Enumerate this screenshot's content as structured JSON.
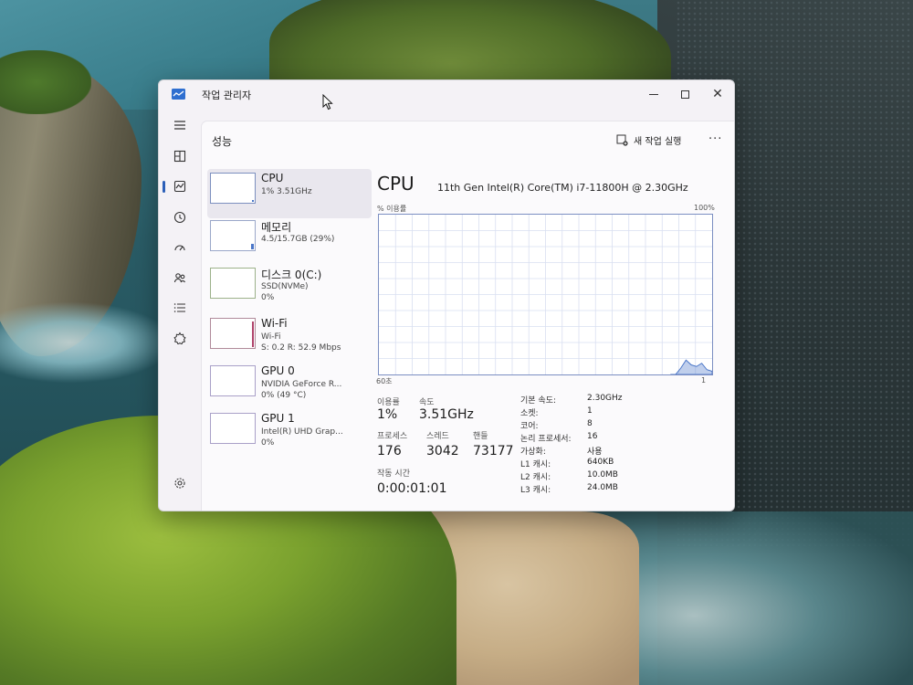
{
  "window": {
    "title": "작업 관리자",
    "page_title": "성능",
    "run_task_label": "새 작업 실행",
    "more_label": "···",
    "close_label": "✕"
  },
  "sidebar": [
    {
      "name": "hamburger-icon"
    },
    {
      "name": "processes-icon"
    },
    {
      "name": "performance-icon",
      "active": true
    },
    {
      "name": "app-history-icon"
    },
    {
      "name": "startup-apps-icon"
    },
    {
      "name": "users-icon"
    },
    {
      "name": "details-icon"
    },
    {
      "name": "services-icon"
    },
    {
      "name": "settings-icon"
    }
  ],
  "perf_items": [
    {
      "name": "CPU",
      "sub1": "1% 3.51GHz",
      "sub2": ""
    },
    {
      "name": "메모리",
      "sub1": "4.5/15.7GB (29%)",
      "sub2": ""
    },
    {
      "name": "디스크 0(C:)",
      "sub1": "SSD(NVMe)",
      "sub2": "0%"
    },
    {
      "name": "Wi-Fi",
      "sub1": "Wi-Fi",
      "sub2": "S: 0.2  R: 52.9 Mbps"
    },
    {
      "name": "GPU 0",
      "sub1": "NVIDIA GeForce R...",
      "sub2": "0% (49 °C)"
    },
    {
      "name": "GPU 1",
      "sub1": "Intel(R) UHD Grap...",
      "sub2": "0%"
    }
  ],
  "cpu": {
    "title": "CPU",
    "model": "11th Gen Intel(R) Core(TM) i7-11800H @ 2.30GHz",
    "util_label": "% 이용률",
    "util_max": "100%",
    "axis_left": "60초",
    "axis_right": "1",
    "utilization_label": "이용률",
    "utilization": "1%",
    "speed_label": "속도",
    "speed": "3.51GHz",
    "processes_label": "프로세스",
    "processes": "176",
    "threads_label": "스레드",
    "threads": "3042",
    "handles_label": "핸들",
    "handles": "73177",
    "uptime_label": "작동 시간",
    "uptime": "0:00:01:01",
    "specs": [
      {
        "label": "기본 속도:",
        "value": "2.30GHz"
      },
      {
        "label": "소켓:",
        "value": "1"
      },
      {
        "label": "코어:",
        "value": "8"
      },
      {
        "label": "논리 프로세서:",
        "value": "16"
      },
      {
        "label": "가상화:",
        "value": "사용"
      },
      {
        "label": "L1 캐시:",
        "value": "640KB"
      },
      {
        "label": "L2 캐시:",
        "value": "10.0MB"
      },
      {
        "label": "L3 캐시:",
        "value": "24.0MB"
      }
    ]
  },
  "colors": {
    "accent": "#2b5fb8",
    "graph_line": "#4a76c8",
    "graph_grid": "#d9dff0"
  }
}
